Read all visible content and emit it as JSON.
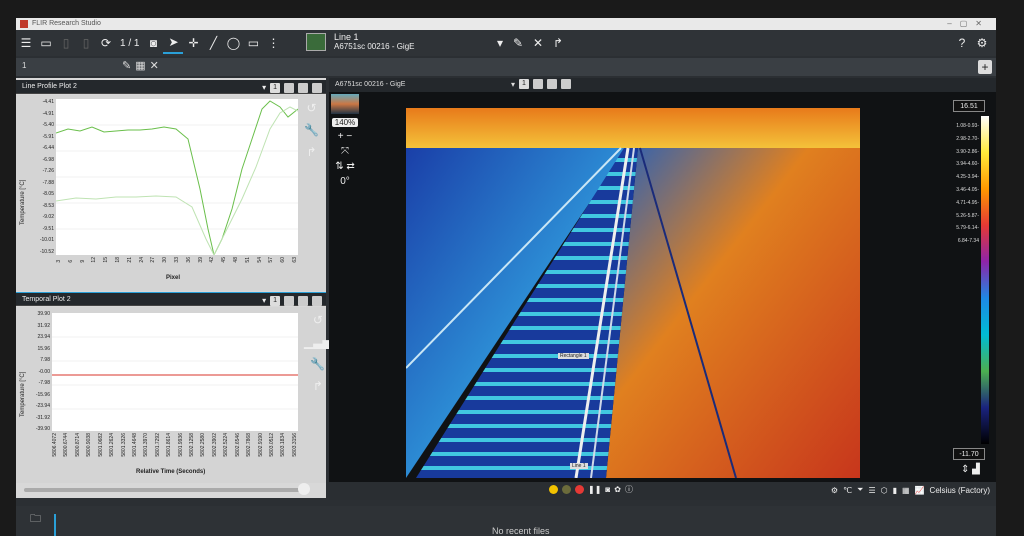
{
  "window": {
    "title": "FLIR Research Studio"
  },
  "toolbar": {
    "page": "1 / 1",
    "line_name": "Line 1",
    "line_camera": "A6751sc 00216 - GigE"
  },
  "tabs": {
    "tab1": "1"
  },
  "line_profile": {
    "title": "Line Profile Plot 2",
    "badge": "1",
    "ylabel": "Temperature [°C]",
    "xlabel": "Pixel",
    "yticks": [
      "-4.41",
      "-4.91",
      "-5.40",
      "-5.91",
      "-6.44",
      "-6.98",
      "-7.26",
      "-7.88",
      "-8.05",
      "-8.53",
      "-9.02",
      "-9.51",
      "-10.01",
      "-10.52"
    ],
    "xticks": [
      "3",
      "6",
      "9",
      "12",
      "15",
      "18",
      "21",
      "24",
      "27",
      "30",
      "33",
      "36",
      "39",
      "42",
      "45",
      "48",
      "51",
      "54",
      "57",
      "60",
      "63"
    ]
  },
  "temporal": {
    "title": "Temporal Plot 2",
    "badge": "1",
    "ylabel": "Temperature [°C]",
    "xlabel": "Relative Time (Seconds)",
    "yticks": [
      "39.90",
      "31.92",
      "23.94",
      "15.96",
      "7.98",
      "-0.00",
      "-7.98",
      "-15.96",
      "-23.94",
      "-31.92",
      "-39.90"
    ],
    "xticks": [
      "5806.4072",
      "5800.6744",
      "5800.8714",
      "5800.9038",
      "5801.0682",
      "5801.2624",
      "5801.3326",
      "5801.4648",
      "5801.3970",
      "5801.7292",
      "5801.8614",
      "5801.9936",
      "5802.1258",
      "5802.2580",
      "5802.3902",
      "5802.5224",
      "5802.6546",
      "5802.7868",
      "5802.9190",
      "5803.0512",
      "5803.1834",
      "5803.3156"
    ]
  },
  "view": {
    "title": "A6751sc 00216 - GigE",
    "badge": "1",
    "zoom": "140%",
    "rotation": "0°",
    "annotations": {
      "rect": "Rectangle 1",
      "line": "Line 1"
    }
  },
  "scale": {
    "max": "16.51",
    "min": "-11.70",
    "unit": "Celsius (Factory)",
    "ticks": [
      "1.08",
      "-0.93",
      "-2.98",
      "-2.70",
      "-3.90",
      "-2.86",
      "-3.94",
      "-4.60",
      "-4.25",
      "-3.94",
      "-3.46",
      "-4.05",
      "-4.71",
      "-4.95",
      "-5.26",
      "-5.87",
      "-5.79",
      "-6.14",
      "-6.84",
      "-7.34"
    ]
  },
  "footer": {
    "no_recent": "No recent files"
  },
  "colors": {
    "accent": "#2aa0d8",
    "plot_green": "#6abf4b",
    "plot_red": "#d9342b"
  }
}
